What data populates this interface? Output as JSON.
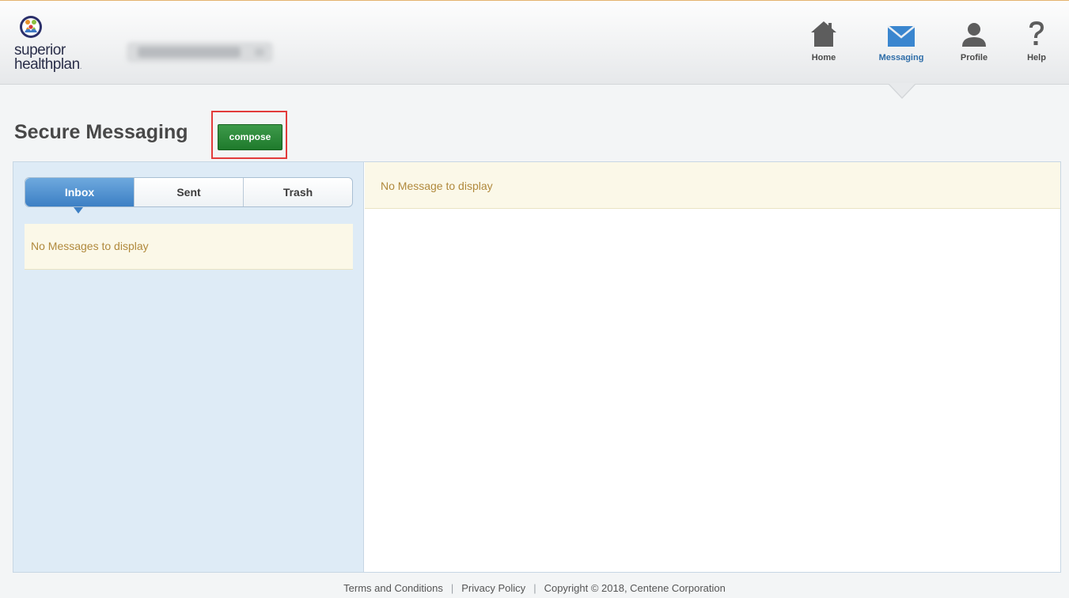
{
  "brand": {
    "line1": "superior",
    "line2": "healthplan",
    "dot": ".",
    "logo_icon": "family-logo-icon"
  },
  "colors": {
    "header_accent": "#e4b36f",
    "nav_active": "#2e6da8",
    "compose_green": "#1f7a2c",
    "tab_active_blue": "#3c7fc4",
    "highlight_red": "#e23b3b",
    "empty_notice_text": "#b0893c"
  },
  "nav": {
    "items": [
      {
        "label": "Home",
        "icon": "home-icon"
      },
      {
        "label": "Messaging",
        "icon": "envelope-icon",
        "active": true
      },
      {
        "label": "Profile",
        "icon": "user-icon"
      },
      {
        "label": "Help",
        "icon": "question-icon"
      }
    ]
  },
  "page": {
    "title": "Secure Messaging",
    "compose_label": "compose"
  },
  "mailbox": {
    "tabs": [
      {
        "label": "Inbox",
        "active": true
      },
      {
        "label": "Sent"
      },
      {
        "label": "Trash"
      }
    ],
    "empty_list": "No Messages to display",
    "empty_message": "No Message to display"
  },
  "footer": {
    "terms": "Terms and Conditions",
    "privacy": "Privacy Policy",
    "copyright": "Copyright © 2018, Centene Corporation"
  }
}
